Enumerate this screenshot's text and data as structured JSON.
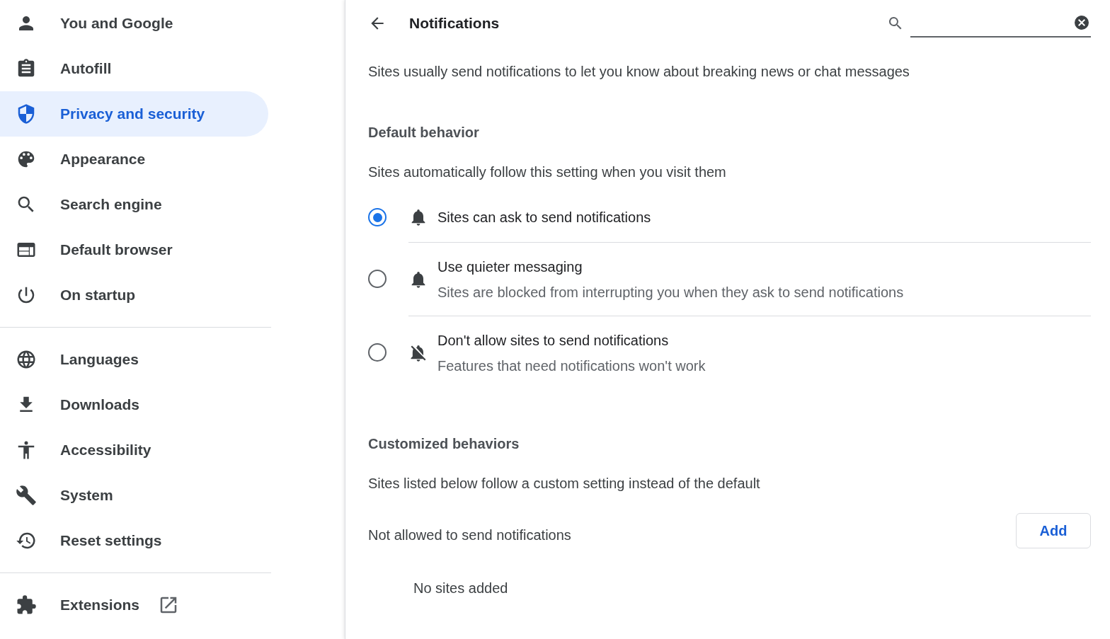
{
  "sidebar": {
    "groups": [
      {
        "items": [
          {
            "label": "You and Google",
            "selected": false,
            "kind": "page"
          },
          {
            "label": "Autofill",
            "selected": false,
            "kind": "page"
          },
          {
            "label": "Privacy and security",
            "selected": true,
            "kind": "page"
          },
          {
            "label": "Appearance",
            "selected": false,
            "kind": "page"
          },
          {
            "label": "Search engine",
            "selected": false,
            "kind": "page"
          },
          {
            "label": "Default browser",
            "selected": false,
            "kind": "page"
          },
          {
            "label": "On startup",
            "selected": false,
            "kind": "page"
          }
        ]
      },
      {
        "items": [
          {
            "label": "Languages",
            "selected": false,
            "kind": "page"
          },
          {
            "label": "Downloads",
            "selected": false,
            "kind": "page"
          },
          {
            "label": "Accessibility",
            "selected": false,
            "kind": "page"
          },
          {
            "label": "System",
            "selected": false,
            "kind": "page"
          },
          {
            "label": "Reset settings",
            "selected": false,
            "kind": "page"
          }
        ]
      },
      {
        "items": [
          {
            "label": "Extensions",
            "selected": false,
            "kind": "external"
          }
        ]
      }
    ]
  },
  "header": {
    "title": "Notifications"
  },
  "description": "Sites usually send notifications to let you know about breaking news or chat messages",
  "default_behavior": {
    "heading": "Default behavior",
    "subtitle": "Sites automatically follow this setting when you visit them",
    "options": [
      {
        "kind": "ask",
        "label": "Sites can ask to send notifications",
        "selected": true
      },
      {
        "kind": "quiet",
        "label": "Use quieter messaging",
        "sublabel": "Sites are blocked from interrupting you when they ask to send notifications",
        "selected": false
      },
      {
        "kind": "block",
        "label": "Don't allow sites to send notifications",
        "sublabel": "Features that need notifications won't work",
        "selected": false
      }
    ]
  },
  "customized_behaviors": {
    "heading": "Customized behaviors",
    "subtitle": "Sites listed below follow a custom setting instead of the default",
    "sections": [
      {
        "label": "Not allowed to send notifications",
        "button": "Add",
        "empty_text": "No sites added"
      }
    ]
  }
}
